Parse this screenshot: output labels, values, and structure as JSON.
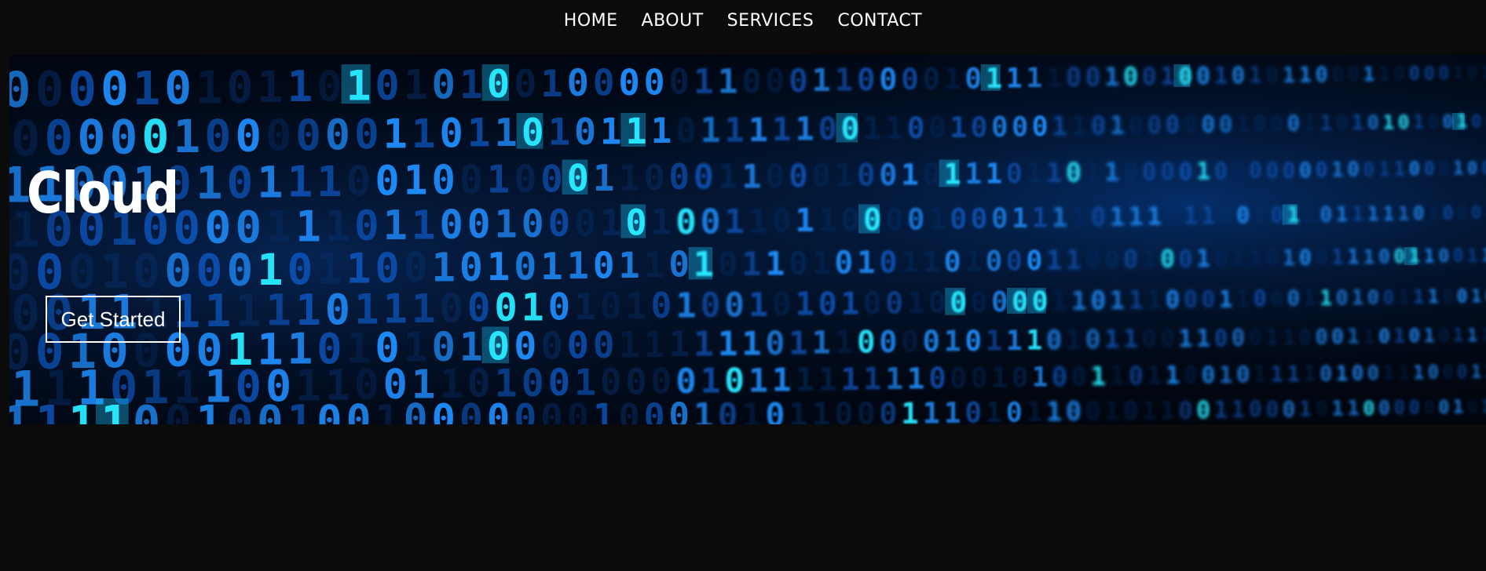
{
  "nav": {
    "items": [
      {
        "label": "HOME"
      },
      {
        "label": "ABOUT"
      },
      {
        "label": "SERVICES"
      },
      {
        "label": "CONTACT"
      }
    ]
  },
  "hero": {
    "title": "Cloud",
    "button_label": "Get Started",
    "background": "binary-code-image"
  },
  "colors": {
    "page_background": "#0c0b0c",
    "text": "#ffffff",
    "accent_glow": "#1aa0ff",
    "accent_cyan": "#19e0ff"
  }
}
